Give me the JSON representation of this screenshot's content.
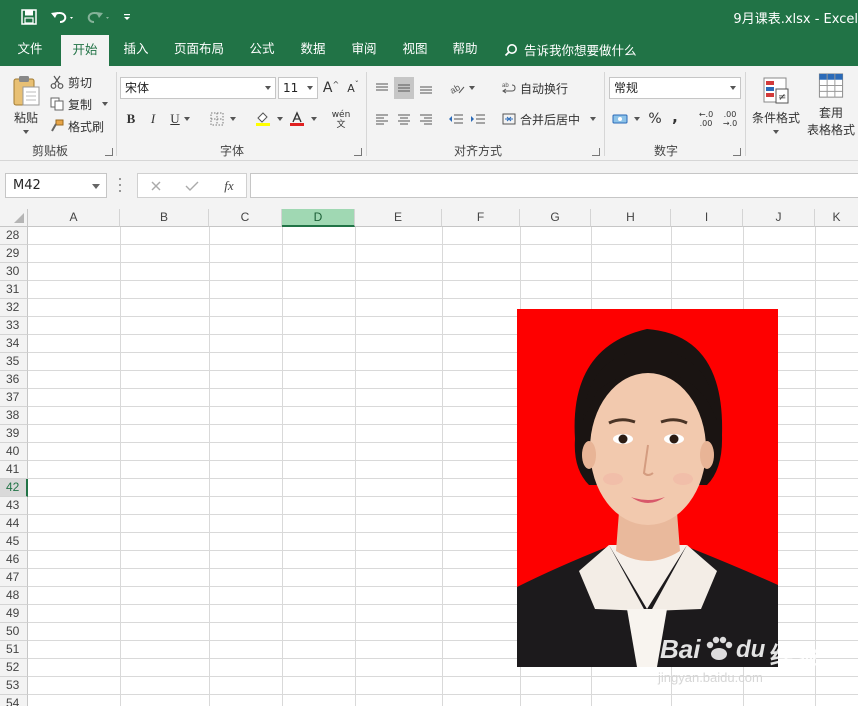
{
  "window": {
    "title": "9月课表.xlsx  -  Excel"
  },
  "quick_access": {
    "icons": [
      "save-icon",
      "undo-icon",
      "redo-icon",
      "customize-icon"
    ]
  },
  "tabs": [
    "文件",
    "开始",
    "插入",
    "页面布局",
    "公式",
    "数据",
    "审阅",
    "视图",
    "帮助"
  ],
  "active_tab": "开始",
  "tell_me": "告诉我你想要做什么",
  "ribbon": {
    "clipboard": {
      "paste": "粘贴",
      "cut": "剪切",
      "copy": "复制",
      "format_painter": "格式刷",
      "group": "剪贴板"
    },
    "font": {
      "font_name": "宋体",
      "font_size": "11",
      "bold": "B",
      "italic": "I",
      "underline": "U",
      "group": "字体",
      "grow": "A",
      "shrink": "A",
      "phonetic_top": "wén",
      "phonetic_bottom": "文"
    },
    "alignment": {
      "wrap": "自动换行",
      "merge": "合并后居中",
      "group": "对齐方式"
    },
    "number": {
      "format": "常规",
      "percent": "%",
      "comma": ",",
      "inc_decimal": ".00",
      "dec_decimal": ".00",
      "group": "数字"
    },
    "styles": {
      "conditional": "条件格式",
      "table_format_1": "套用",
      "table_format_2": "表格格式"
    }
  },
  "formula_bar": {
    "name_box": "M42",
    "fx": "fx",
    "value": ""
  },
  "columns": [
    "A",
    "B",
    "C",
    "D",
    "E",
    "F",
    "G",
    "H",
    "I",
    "J",
    "K"
  ],
  "selected_column": "D",
  "rows": [
    "28",
    "29",
    "30",
    "31",
    "32",
    "33",
    "34",
    "35",
    "36",
    "37",
    "38",
    "39",
    "40",
    "41",
    "42",
    "43",
    "44",
    "45",
    "46",
    "47",
    "48",
    "49",
    "50",
    "51",
    "52",
    "53",
    "54"
  ],
  "selected_row": "42",
  "watermark": {
    "brand_1": "Bai",
    "brand_2": "du",
    "brand_3": "经验",
    "url": "jingyan.baidu.com"
  },
  "colors": {
    "excel_green": "#217346",
    "photo_background": "#fe0000",
    "selected_header": "#a0d8b3"
  }
}
